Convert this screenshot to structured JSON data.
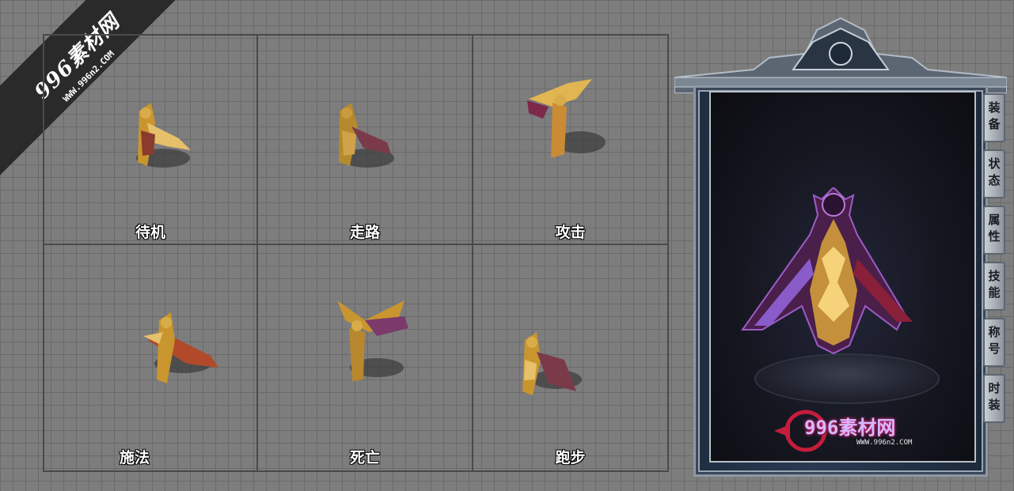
{
  "watermark": {
    "site": "996素材网",
    "url": "WWW.996n2.COM"
  },
  "animations": [
    {
      "label": "待机"
    },
    {
      "label": "走路"
    },
    {
      "label": "攻击"
    },
    {
      "label": "施法"
    },
    {
      "label": "死亡"
    },
    {
      "label": "跑步"
    }
  ],
  "panel": {
    "tabs": [
      "装备",
      "状态",
      "属性",
      "技能",
      "称号",
      "时装"
    ],
    "logo": {
      "text": "996素材网",
      "url": "WWW.996n2.COM"
    }
  },
  "colors": {
    "gold": "#d9a53a",
    "purple": "#6b2a8a",
    "crimson": "#8a1f3a"
  }
}
